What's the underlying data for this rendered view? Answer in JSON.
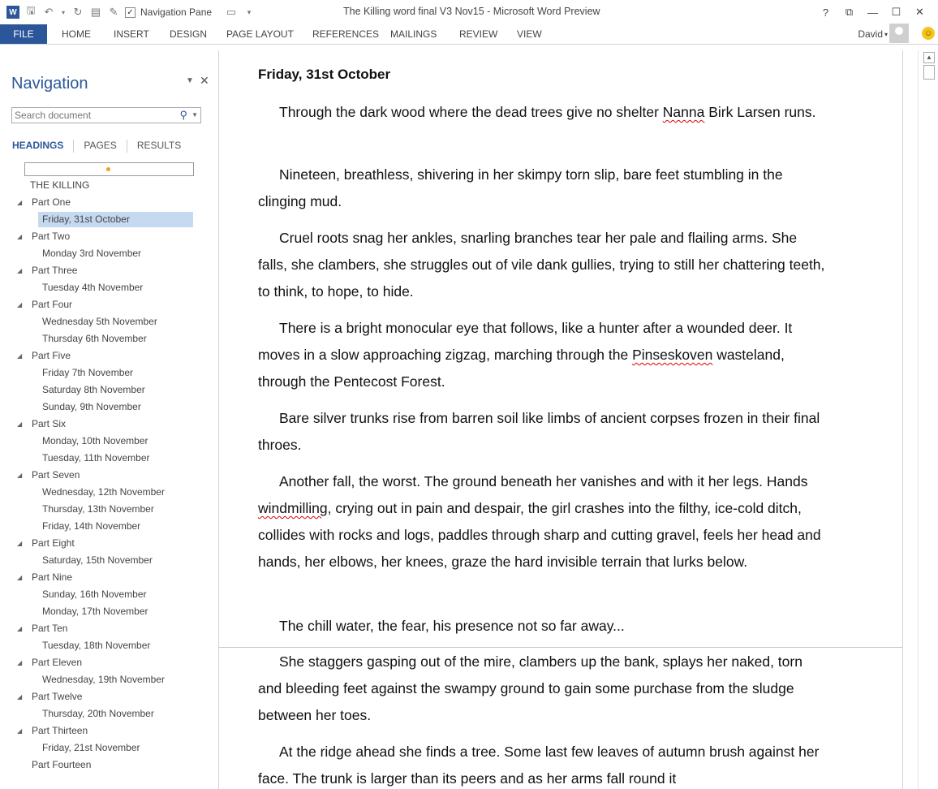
{
  "window": {
    "title": "The Killing word final V3 Nov15 - Microsoft Word Preview",
    "quick_access": {
      "nav_pane_label": "Navigation Pane",
      "icons": [
        "word-logo-icon",
        "save-icon",
        "undo-icon",
        "redo-icon",
        "page-icon",
        "new-doc-icon",
        "checkbox-icon",
        "layout-icon",
        "customize-icon"
      ]
    },
    "controls": {
      "help": "?",
      "restore": "⧉",
      "minimize": "—",
      "maximize": "☐",
      "close": "✕"
    }
  },
  "ribbon": {
    "tabs": [
      "FILE",
      "HOME",
      "INSERT",
      "DESIGN",
      "PAGE LAYOUT",
      "REFERENCES",
      "MAILINGS",
      "REVIEW",
      "VIEW"
    ],
    "user": "David"
  },
  "navigation": {
    "title": "Navigation",
    "search_placeholder": "Search document",
    "tabs": [
      "HEADINGS",
      "PAGES",
      "RESULTS"
    ],
    "headings": [
      {
        "text": "THE KILLING",
        "level": 0
      },
      {
        "text": "Part One",
        "level": 1,
        "expanded": true
      },
      {
        "text": "Friday, 31st October",
        "level": 2,
        "selected": true
      },
      {
        "text": "Part Two",
        "level": 1,
        "expanded": true
      },
      {
        "text": "Monday 3rd November",
        "level": 2
      },
      {
        "text": "Part Three",
        "level": 1,
        "expanded": true
      },
      {
        "text": "Tuesday 4th November",
        "level": 2
      },
      {
        "text": "Part Four",
        "level": 1,
        "expanded": true
      },
      {
        "text": "Wednesday 5th November",
        "level": 2
      },
      {
        "text": "Thursday 6th November",
        "level": 2
      },
      {
        "text": "Part Five",
        "level": 1,
        "expanded": true
      },
      {
        "text": "Friday 7th November",
        "level": 2
      },
      {
        "text": "Saturday 8th November",
        "level": 2
      },
      {
        "text": "Sunday, 9th November",
        "level": 2
      },
      {
        "text": "Part Six",
        "level": 1,
        "expanded": true
      },
      {
        "text": "Monday, 10th November",
        "level": 2
      },
      {
        "text": "Tuesday, 11th November",
        "level": 2
      },
      {
        "text": "Part Seven",
        "level": 1,
        "expanded": true
      },
      {
        "text": "Wednesday, 12th November",
        "level": 2
      },
      {
        "text": "Thursday, 13th November",
        "level": 2
      },
      {
        "text": "Friday, 14th November",
        "level": 2
      },
      {
        "text": "Part Eight",
        "level": 1,
        "expanded": true
      },
      {
        "text": "Saturday, 15th November",
        "level": 2
      },
      {
        "text": "Part Nine",
        "level": 1,
        "expanded": true
      },
      {
        "text": "Sunday, 16th November",
        "level": 2
      },
      {
        "text": "Monday, 17th November",
        "level": 2
      },
      {
        "text": "Part Ten",
        "level": 1,
        "expanded": true
      },
      {
        "text": "Tuesday, 18th November",
        "level": 2
      },
      {
        "text": "Part Eleven",
        "level": 1,
        "expanded": true
      },
      {
        "text": "Wednesday, 19th November",
        "level": 2
      },
      {
        "text": "Part Twelve",
        "level": 1,
        "expanded": true
      },
      {
        "text": "Thursday, 20th November",
        "level": 2
      },
      {
        "text": "Part Thirteen",
        "level": 1,
        "expanded": true
      },
      {
        "text": "Friday, 21st November",
        "level": 2
      },
      {
        "text": "Part Fourteen",
        "level": 1
      }
    ]
  },
  "document": {
    "heading": "Friday, 31st October",
    "paragraphs": [
      {
        "segments": [
          {
            "t": "Through the dark wood where the dead trees give no shelter "
          },
          {
            "t": "Nanna",
            "squig": true
          },
          {
            "t": " Birk Larsen runs."
          }
        ]
      },
      {
        "segments": [
          {
            "t": "Nineteen, breathless, shivering in her skimpy torn slip, bare feet stumbling in the clinging mud."
          }
        ]
      },
      {
        "segments": [
          {
            "t": "Cruel roots snag her ankles, snarling branches tear her pale and flailing arms. She falls, she clambers, she struggles out of vile dank gullies, trying to still her chattering teeth, to think, to hope, to hide."
          }
        ]
      },
      {
        "segments": [
          {
            "t": "There is a bright monocular eye that follows, like a hunter after a wounded deer. It moves in a slow approaching zigzag, marching through the "
          },
          {
            "t": "Pinseskoven",
            "squig": true
          },
          {
            "t": " wasteland, through the Pentecost Forest."
          }
        ]
      },
      {
        "segments": [
          {
            "t": "Bare silver trunks rise from barren soil like limbs of ancient corpses frozen in their final throes."
          }
        ]
      },
      {
        "segments": [
          {
            "t": "Another fall, the worst. The ground beneath her vanishes and with it her legs. Hands "
          },
          {
            "t": "windmilling",
            "squig": true
          },
          {
            "t": ", crying out in pain and despair, the girl crashes into the filthy, ice-cold ditch, collides with rocks and logs, paddles through sharp and cutting gravel, feels her head and hands, her elbows, her knees, graze the hard invisible terrain that lurks below."
          }
        ]
      },
      {
        "segments": [
          {
            "t": "The chill water, the fear, his presence not so far away..."
          }
        ]
      },
      {
        "segments": [
          {
            "t": "She staggers gasping out of the mire, clambers up the bank, splays her naked, torn and bleeding feet against the swampy ground to gain some purchase from the sludge between her toes."
          }
        ]
      },
      {
        "segments": [
          {
            "t": "At the ridge ahead she finds a tree. Some last few leaves of autumn brush against her face. The trunk is larger than its peers and as her arms fall round it"
          }
        ]
      }
    ]
  }
}
